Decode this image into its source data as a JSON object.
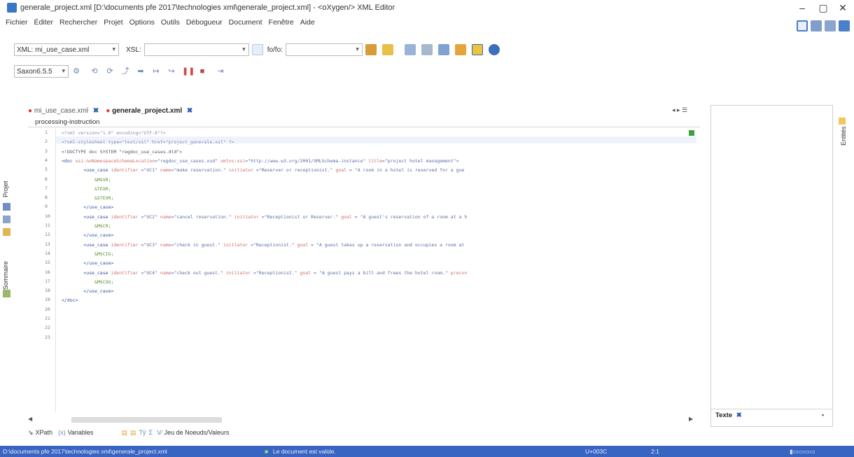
{
  "window": {
    "title": "generale_project.xml [D:\\documents pfe 2017\\technologies xml\\generale_project.xml] - <oXygen/> XML Editor",
    "minimize": "–",
    "maximize": "▢",
    "close": "✕"
  },
  "menu": [
    "Fichier",
    "Éditer",
    "Rechercher",
    "Projet",
    "Options",
    "Outils",
    "Débogueur",
    "Document",
    "Fenêtre",
    "Aide"
  ],
  "toolbar": {
    "xml_label": "XML:",
    "xml_value": "mi_use_case.xml",
    "xsl_label": "XSL:",
    "xsl_value": "",
    "fo_label": "fo/fo:",
    "fo_value": "",
    "saxon_value": "Saxon6.5.5"
  },
  "tabs": [
    {
      "label": "mi_use_case.xml",
      "modified": true,
      "close": "✖"
    },
    {
      "label": "generale_project.xml",
      "modified": true,
      "close": "✖",
      "active": true
    }
  ],
  "breadcrumb": "processing-instruction",
  "editor": {
    "line_numbers": [
      "1",
      "2",
      "3",
      "4",
      "5",
      "6",
      "7",
      "8",
      "9",
      "10",
      "11",
      "12",
      "13",
      "14",
      "15",
      "16",
      "17",
      "18",
      "19",
      "20",
      "21",
      "22",
      "23"
    ],
    "lines": [
      [
        {
          "c": "t-pi",
          "t": "<?xml version=\"1.0\" encoding=\"UTF-8\"?>"
        }
      ],
      [
        {
          "c": "t-pi",
          "t": "<?xml-stylesheet type=\"text/xsl\" href=\"project_generale.xsl\" ?>"
        }
      ],
      [
        {
          "c": "t-dt",
          "t": "<!DOCTYPE doc SYSTEM \"regdoc_use_cases.dtd\">"
        }
      ],
      [
        {
          "c": "t-tag",
          "t": "<doc "
        },
        {
          "c": "t-attr",
          "t": "xsi:noNamespaceSchemaLocation"
        },
        {
          "c": "t-val",
          "t": "=\"regdoc_use_cases.xsd\" "
        },
        {
          "c": "t-attr",
          "t": "xmlns:xsi"
        },
        {
          "c": "t-val",
          "t": "=\"http://www.w3.org/2001/XMLSchema-instance\" "
        },
        {
          "c": "t-attr",
          "t": "title"
        },
        {
          "c": "t-val",
          "t": "=\"project hotel management\">"
        }
      ],
      [
        {
          "c": "t-tag",
          "t": "        <use_case "
        },
        {
          "c": "t-attr",
          "t": "identifier "
        },
        {
          "c": "t-val",
          "t": "=\"UC1\" "
        },
        {
          "c": "t-attr",
          "t": "name"
        },
        {
          "c": "t-val",
          "t": "=\"make reservation.\" "
        },
        {
          "c": "t-attr",
          "t": "initiator "
        },
        {
          "c": "t-val",
          "t": "=\"Reserver or receptionist.\" "
        },
        {
          "c": "t-attr",
          "t": "goal "
        },
        {
          "c": "t-val",
          "t": "= \"A room in a hotel is reserved for a gue"
        }
      ],
      [
        {
          "c": "t-text",
          "t": "            &MSSR;"
        }
      ],
      [
        {
          "c": "t-text",
          "t": "            &TEXR;"
        }
      ],
      [
        {
          "c": "t-text",
          "t": "            &STEXR;"
        }
      ],
      [
        {
          "c": "t-tag",
          "t": "        </use_case>"
        }
      ],
      [
        {
          "c": "t-tag",
          "t": "        <use_case "
        },
        {
          "c": "t-attr",
          "t": "identifier "
        },
        {
          "c": "t-val",
          "t": "=\"UC2\" "
        },
        {
          "c": "t-attr",
          "t": "name"
        },
        {
          "c": "t-val",
          "t": "=\"cancel reservation.\" "
        },
        {
          "c": "t-attr",
          "t": "initiator "
        },
        {
          "c": "t-val",
          "t": "=\"Receptionist or Reserver.\" "
        },
        {
          "c": "t-attr",
          "t": "goal "
        },
        {
          "c": "t-val",
          "t": "= \"A guest's reservation of a room at a h"
        }
      ],
      [
        {
          "c": "t-text",
          "t": "            &MSCR;"
        }
      ],
      [
        {
          "c": "t-tag",
          "t": "        </use_case>"
        }
      ],
      [
        {
          "c": "t-tag",
          "t": "        <use_case "
        },
        {
          "c": "t-attr",
          "t": "identifier "
        },
        {
          "c": "t-val",
          "t": "=\"UC3\" "
        },
        {
          "c": "t-attr",
          "t": "name"
        },
        {
          "c": "t-val",
          "t": "=\"check in guest.\" "
        },
        {
          "c": "t-attr",
          "t": "initiator "
        },
        {
          "c": "t-val",
          "t": "=\"Receptionist.\" "
        },
        {
          "c": "t-attr",
          "t": "goal "
        },
        {
          "c": "t-val",
          "t": "= \"A guest takes up a reservation and occupies a room at "
        }
      ],
      [
        {
          "c": "t-text",
          "t": "            &MSCIG;"
        }
      ],
      [
        {
          "c": "t-tag",
          "t": "        </use_case>"
        }
      ],
      [
        {
          "c": "t-tag",
          "t": "        <use_case "
        },
        {
          "c": "t-attr",
          "t": "identifier "
        },
        {
          "c": "t-val",
          "t": "=\"UC4\" "
        },
        {
          "c": "t-attr",
          "t": "name"
        },
        {
          "c": "t-val",
          "t": "=\"check out guest.\" "
        },
        {
          "c": "t-attr",
          "t": "initiator "
        },
        {
          "c": "t-val",
          "t": "=\"Receptionist.\" "
        },
        {
          "c": "t-attr",
          "t": "goal "
        },
        {
          "c": "t-val",
          "t": "= \"A guest pays a bill and frees the hotel room.\" "
        },
        {
          "c": "t-attr",
          "t": "precon"
        }
      ],
      [
        {
          "c": "t-text",
          "t": "            &MSCOG;"
        }
      ],
      [
        {
          "c": "t-tag",
          "t": "        </use_case>"
        }
      ],
      [
        {
          "c": "t-tag",
          "t": "</doc>"
        }
      ],
      [],
      [],
      [],
      []
    ]
  },
  "side": {
    "projet": "Projet",
    "sommaire": "Sommaire",
    "entites": "Entités",
    "texte_tab": "Texte",
    "texte_close": "✖"
  },
  "bottom": {
    "xpath": "XPath",
    "variables": "Variables",
    "jeu": "Jeu de Noeuds/Valeurs"
  },
  "status": {
    "path": "D:\\documents pfe 2017\\technologies xml\\generale_project.xml",
    "valid": "Le document est valide.",
    "encoding": "U+003C",
    "position": "2:1"
  },
  "colors": {
    "accent": "#3864c2",
    "valid_marker": "#3aa33a",
    "modified_tab": "#d33333"
  }
}
